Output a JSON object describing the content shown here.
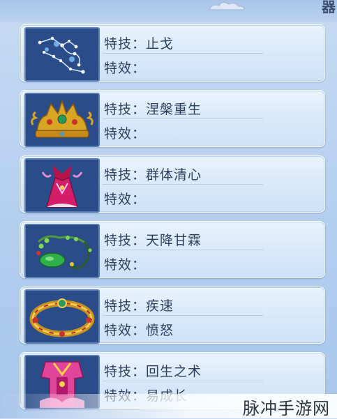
{
  "header": {
    "corner_glyph": "器"
  },
  "items": [
    {
      "skill_label": "特技：",
      "skill_value": "止戈",
      "effect_label": "特效：",
      "effect_value": "",
      "icon": "constellation-icon"
    },
    {
      "skill_label": "特技：",
      "skill_value": "涅槃重生",
      "effect_label": "特效：",
      "effect_value": "",
      "icon": "golden-crown-icon"
    },
    {
      "skill_label": "特技：",
      "skill_value": "群体清心",
      "effect_label": "特效：",
      "effect_value": "",
      "icon": "pink-robe-icon"
    },
    {
      "skill_label": "特技：",
      "skill_value": "天降甘霖",
      "effect_label": "特效：",
      "effect_value": "",
      "icon": "jade-necklace-icon"
    },
    {
      "skill_label": "特技：",
      "skill_value": "疾速",
      "effect_label": "特效：",
      "effect_value": "愤怒",
      "icon": "gold-ring-icon"
    },
    {
      "skill_label": "特技：",
      "skill_value": "回生之术",
      "effect_label": "特效：",
      "effect_value": "易成长",
      "icon": "pink-garment-icon"
    }
  ],
  "watermark": "脉冲手游网"
}
